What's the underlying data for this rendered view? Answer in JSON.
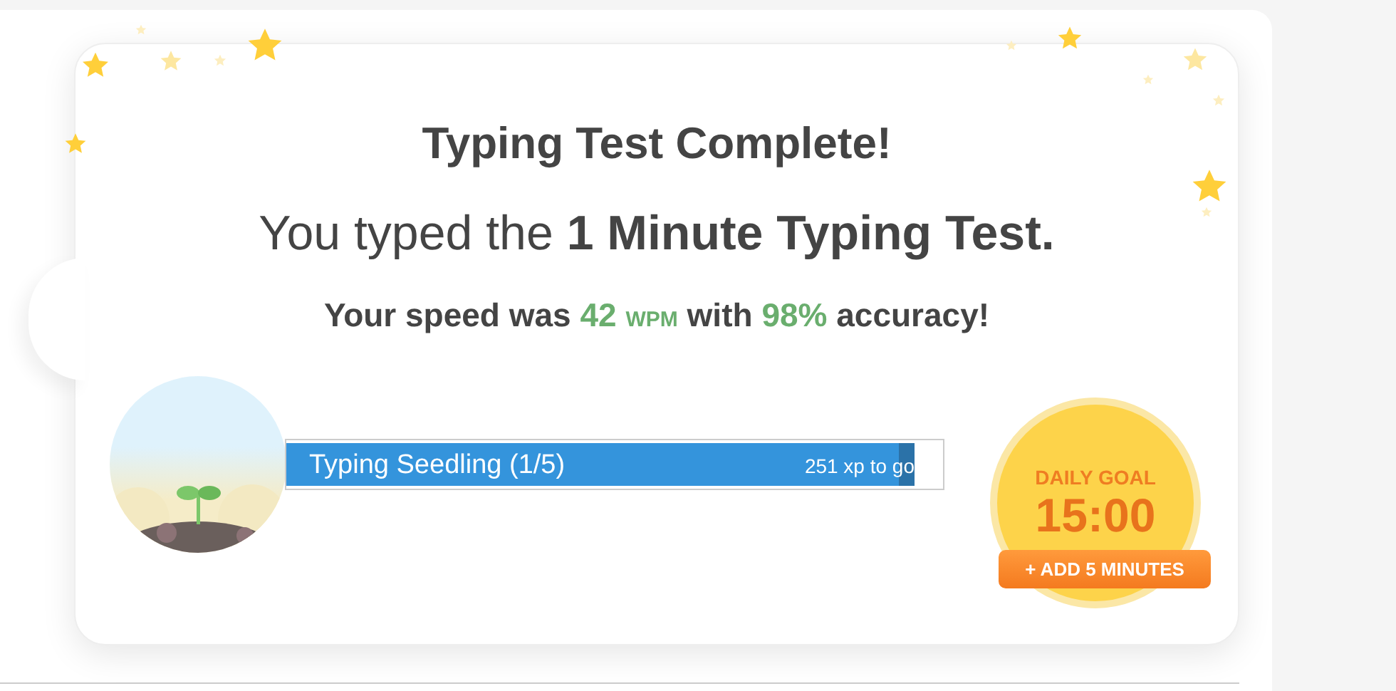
{
  "result": {
    "title": "Typing Test Complete!",
    "subtitle": "You typed the **1 Minute Typing Test.**",
    "speed": {
      "prefix": "Your speed was",
      "wpm": "42",
      "unit": "WPM",
      "middle": "with",
      "accuracy": "98%",
      "suffix": "accuracy!"
    }
  },
  "rank": {
    "label": "Typing Seedling (1/5)",
    "remaining": "251 xp to go",
    "level": 0.957
  },
  "daily_goal": {
    "label": "DAILY GOAL",
    "time": "15:00",
    "button": "+ ADD 5 MINUTES"
  }
}
